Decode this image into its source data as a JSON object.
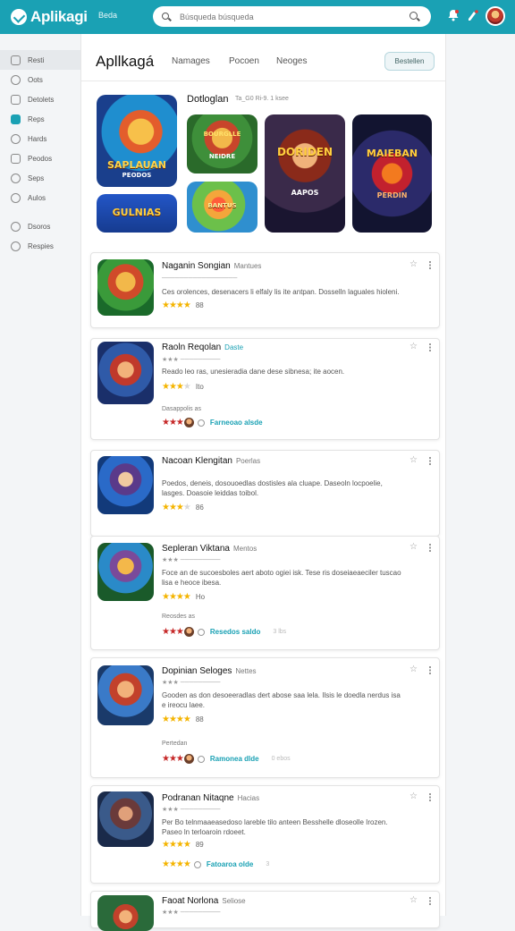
{
  "app": {
    "name": "Aplikagi",
    "nav_label": "Beda"
  },
  "search": {
    "placeholder": "Búsqueda búsqueda"
  },
  "topbar_icons": [
    "bell-icon",
    "settings-icon"
  ],
  "sidebar": {
    "items": [
      {
        "label": "Resti",
        "icon": "home-icon",
        "active": true
      },
      {
        "label": "Oots",
        "icon": "clock-icon"
      },
      {
        "label": "Detolets",
        "icon": "list-icon"
      },
      {
        "label": "Reps",
        "icon": "apps-icon",
        "accent": true
      },
      {
        "label": "Hards",
        "icon": "heart-icon"
      },
      {
        "label": "Peodos",
        "icon": "bookmark-icon"
      },
      {
        "label": "Seps",
        "icon": "gear-icon"
      },
      {
        "label": "Aulos",
        "icon": "star-icon"
      }
    ],
    "secondary": [
      {
        "label": "Dsoros",
        "icon": "user-icon"
      },
      {
        "label": "Respies",
        "icon": "info-icon"
      }
    ]
  },
  "main": {
    "title": "Apllkagá",
    "tabs": [
      "Namages",
      "Pocoen",
      "Neoges"
    ],
    "button": "Bestellen"
  },
  "featured": {
    "title": "Dotloglan",
    "subtitle": "Ta_G0 Ri-9. 1 ksee",
    "art": [
      {
        "caption": "SAPLAUAN",
        "subcaption": "PEODOS"
      },
      {
        "caption": "BOURGLLE",
        "subcaption": "NEIDRE"
      },
      {
        "caption": "DORIDEN",
        "subcaption": "AAPOS"
      },
      {
        "caption": "MAIEBAN",
        "subcaption": "PERDIN"
      },
      {
        "caption": "GULNIAS",
        "subcaption": ""
      },
      {
        "caption": "BANTUS",
        "subcaption": ""
      }
    ]
  },
  "accent_color": "#1aa1b4",
  "cards": [
    {
      "title": "Naganin Songian",
      "tag": "Mantues",
      "tag_color": "gray",
      "desc": "Ces orolences, desenacers li elfaly lis ite antpan. Dosselln laguales hioleni.",
      "rating": 4,
      "rating_text": "88",
      "art": "DIRDIBBLE"
    },
    {
      "title": "Raoln Reqolan",
      "tag": "Daste",
      "tag_color": "blue",
      "meta": "★★★ ─────────",
      "desc": "Reado leo ras, unesieradia dane dese sibnesa; ite aocen.",
      "rating": 4,
      "rating_text": "Ito",
      "footer_label": "Dasappolis  as",
      "footer_link": "Farneoao alsde",
      "art": "REIDAS"
    },
    {
      "title": "Nacoan Klengitan",
      "tag": "Poerlas",
      "tag_color": "gray",
      "desc": "Poedos, deneis, dosouoedlas dostisles ala cluape. Daseoln locpoelie, lasges. Doasoie leiddas toibol.",
      "rating": 4,
      "rating_text": "86",
      "art": "BATTLE"
    },
    {
      "title": "Sepleran Viktana",
      "tag": "Mentos",
      "tag_color": "gray",
      "meta": "★★★ ─────────",
      "desc": "Foce an de sucoesboles aert aboto ogiei isk. Tese ris doseiaeaeciler tuscao lisa e heoce ibesa.",
      "rating": 4,
      "rating_text": "Ho",
      "footer_label": "Reosdes  as",
      "footer_link": "Resedos saldo",
      "footer_extra": "3  lbs",
      "art": "DONDLAS"
    },
    {
      "title": "Dopinian Seloges",
      "tag": "Nettes",
      "tag_color": "gray",
      "meta": "★★★ ─────────",
      "desc": "Gooden as don desoeeradlas dert abose saa lela. Ilsis le doedla nerdus isa e ireocu laee.",
      "rating": 4,
      "rating_text": "88",
      "footer_label": "Pertedan",
      "footer_link": "Ramonea dlde",
      "footer_extra": "0  ebos",
      "art": "BEANER"
    },
    {
      "title": "Podranan Nitaqne",
      "tag": "Hacias",
      "tag_color": "gray",
      "meta": "★★★ ─────────",
      "desc": "Per Bo telnmaaeasedoso lareble tilo anteen Besshelle dloseolle Irozen. Paseo ln terloaroin rdoeet.",
      "rating": 4,
      "rating_text": "89",
      "footer_link": "Fatoaroa olde",
      "footer_extra": "3",
      "footer_stars": "gold",
      "art": "WARRIOR"
    },
    {
      "title": "Faoat Norlona",
      "tag": "Seliose",
      "tag_color": "gray",
      "meta": "★★★ ─────────",
      "art": "HERO"
    }
  ]
}
